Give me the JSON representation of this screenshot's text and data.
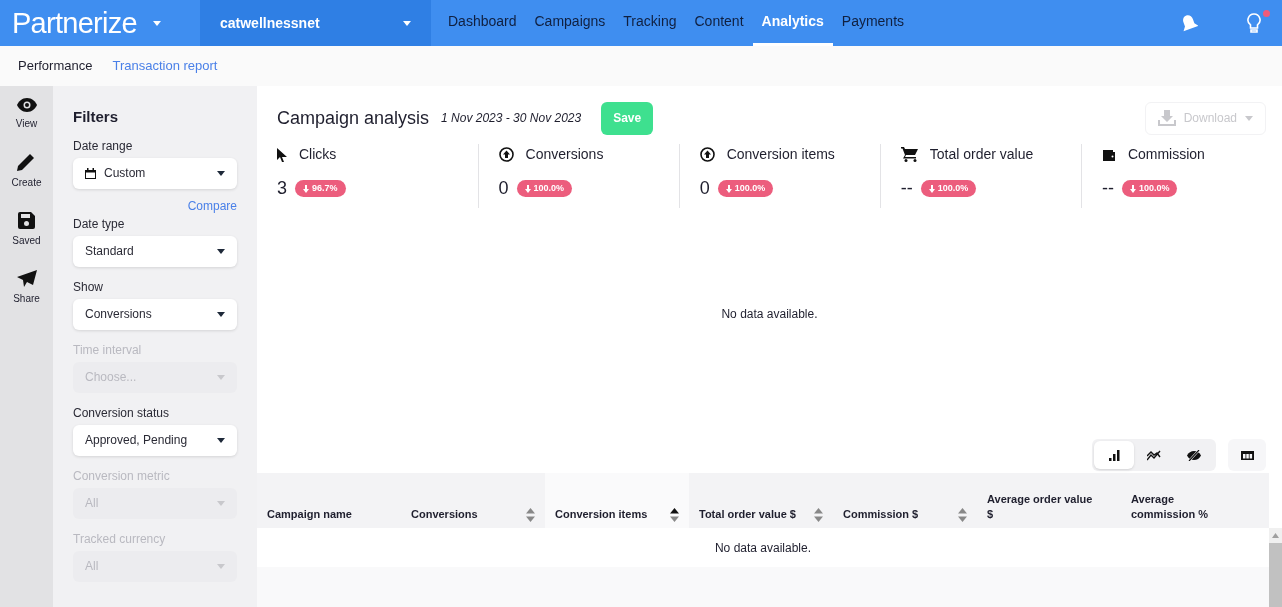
{
  "brand": {
    "logo": "Partnerize"
  },
  "account": {
    "name": "catwellnessnet"
  },
  "nav": [
    {
      "label": "Dashboard",
      "selected": false
    },
    {
      "label": "Campaigns",
      "selected": false
    },
    {
      "label": "Tracking",
      "selected": false
    },
    {
      "label": "Content",
      "selected": false
    },
    {
      "label": "Analytics",
      "selected": true
    },
    {
      "label": "Payments",
      "selected": false
    }
  ],
  "header_icons": {
    "tips_notification": true
  },
  "subnav": [
    {
      "label": "Performance",
      "selected": true
    },
    {
      "label": "Transaction report",
      "selected": false
    }
  ],
  "rail": [
    {
      "kind": "view",
      "label": "View"
    },
    {
      "kind": "create",
      "label": "Create"
    },
    {
      "kind": "saved",
      "label": "Saved"
    },
    {
      "kind": "share",
      "label": "Share"
    }
  ],
  "filters": {
    "title": "Filters",
    "items": [
      {
        "label": "Date range",
        "value": "Custom",
        "kind": "date",
        "disabled": false,
        "link": "Compare"
      },
      {
        "label": "Date type",
        "value": "Standard",
        "kind": "select",
        "disabled": false
      },
      {
        "label": "Show",
        "value": "Conversions",
        "kind": "select",
        "disabled": false
      },
      {
        "label": "Time interval",
        "value": "Choose...",
        "kind": "select",
        "disabled": true
      },
      {
        "label": "Conversion status",
        "value": "Approved, Pending",
        "kind": "select",
        "disabled": false
      },
      {
        "label": "Conversion metric",
        "value": "All",
        "kind": "select",
        "disabled": true
      },
      {
        "label": "Tracked currency",
        "value": "All",
        "kind": "select",
        "disabled": true
      }
    ]
  },
  "report": {
    "title": "Campaign analysis",
    "date_range": "1 Nov 2023 - 30 Nov 2023",
    "save": "Save",
    "download": "Download",
    "download_disabled": true
  },
  "metrics": [
    {
      "kind": "clicks",
      "label": "Clicks",
      "value": "3",
      "change": "96.7%"
    },
    {
      "kind": "conversions",
      "label": "Conversions",
      "value": "0",
      "change": "100.0%"
    },
    {
      "kind": "conversions",
      "label": "Conversion items",
      "value": "0",
      "change": "100.0%"
    },
    {
      "kind": "order",
      "label": "Total order value",
      "value": "--",
      "change": "100.0%"
    },
    {
      "kind": "commission",
      "label": "Commission",
      "value": "--",
      "change": "100.0%"
    }
  ],
  "chart_message": "No data available.",
  "view_toggles": [
    {
      "kind": "bar",
      "selected": true
    },
    {
      "kind": "line",
      "selected": false
    },
    {
      "kind": "hidden",
      "selected": false
    }
  ],
  "table": {
    "columns": [
      {
        "label": "Campaign name",
        "sortable": false
      },
      {
        "label": "Conversions",
        "sortable": true,
        "sorted": false
      },
      {
        "label": "Conversion items",
        "sortable": true,
        "sorted": true
      },
      {
        "label": "Total order value $",
        "sortable": true,
        "sorted": false
      },
      {
        "label": "Commission $",
        "sortable": true,
        "sorted": false
      },
      {
        "label": "Average order value $",
        "sortable": false
      },
      {
        "label": "Average commission %",
        "sortable": false
      }
    ],
    "message": "No data available."
  }
}
